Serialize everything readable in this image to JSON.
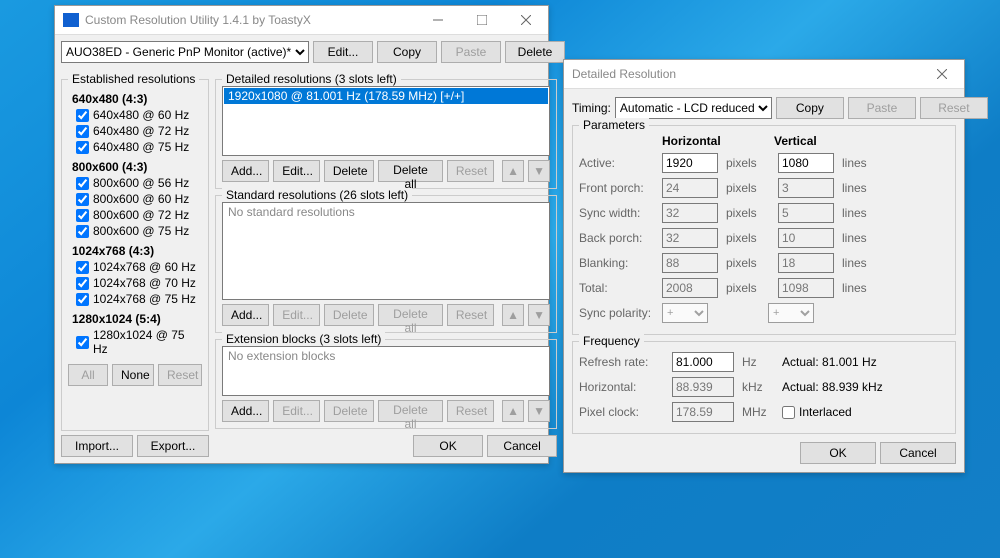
{
  "main": {
    "title": "Custom Resolution Utility 1.4.1 by ToastyX",
    "monitor": "AUO38ED - Generic PnP Monitor (active)*",
    "btn": {
      "edit": "Edit...",
      "copy": "Copy",
      "paste": "Paste",
      "delete": "Delete",
      "add": "Add...",
      "deleteAll": "Delete all",
      "reset": "Reset",
      "all": "All",
      "none": "None",
      "import": "Import...",
      "export": "Export...",
      "ok": "OK",
      "cancel": "Cancel"
    },
    "groups": {
      "established": "Established resolutions",
      "detailed": "Detailed resolutions (3 slots left)",
      "standard": "Standard resolutions (26 slots left)",
      "extension": "Extension blocks (3 slots left)"
    },
    "detailedItem": "1920x1080 @ 81.001 Hz (178.59 MHz) [+/+]",
    "noStandard": "No standard resolutions",
    "noExt": "No extension blocks",
    "res": {
      "g1": "640x480 (4:3)",
      "g1a": "640x480 @ 60 Hz",
      "g1b": "640x480 @ 72 Hz",
      "g1c": "640x480 @ 75 Hz",
      "g2": "800x600 (4:3)",
      "g2a": "800x600 @ 56 Hz",
      "g2b": "800x600 @ 60 Hz",
      "g2c": "800x600 @ 72 Hz",
      "g2d": "800x600 @ 75 Hz",
      "g3": "1024x768 (4:3)",
      "g3a": "1024x768 @ 60 Hz",
      "g3b": "1024x768 @ 70 Hz",
      "g3c": "1024x768 @ 75 Hz",
      "g4": "1280x1024 (5:4)",
      "g4a": "1280x1024 @ 75 Hz"
    }
  },
  "dlg": {
    "title": "Detailed Resolution",
    "timingLabel": "Timing:",
    "timing": "Automatic - LCD reduced",
    "params": "Parameters",
    "hHead": "Horizontal",
    "vHead": "Vertical",
    "rows": {
      "active": {
        "label": "Active:",
        "h": "1920",
        "hu": "pixels",
        "v": "1080",
        "vu": "lines"
      },
      "fp": {
        "label": "Front porch:",
        "h": "24",
        "hu": "pixels",
        "v": "3",
        "vu": "lines"
      },
      "sw": {
        "label": "Sync width:",
        "h": "32",
        "hu": "pixels",
        "v": "5",
        "vu": "lines"
      },
      "bp": {
        "label": "Back porch:",
        "h": "32",
        "hu": "pixels",
        "v": "10",
        "vu": "lines"
      },
      "bl": {
        "label": "Blanking:",
        "h": "88",
        "hu": "pixels",
        "v": "18",
        "vu": "lines"
      },
      "tot": {
        "label": "Total:",
        "h": "2008",
        "hu": "pixels",
        "v": "1098",
        "vu": "lines"
      },
      "sp": {
        "label": "Sync polarity:",
        "hv": "+",
        "vv": "+"
      }
    },
    "freq": {
      "legend": "Frequency",
      "rr": {
        "label": "Refresh rate:",
        "v": "81.000",
        "u": "Hz",
        "actual": "Actual: 81.001 Hz"
      },
      "hz": {
        "label": "Horizontal:",
        "v": "88.939",
        "u": "kHz",
        "actual": "Actual: 88.939 kHz"
      },
      "pc": {
        "label": "Pixel clock:",
        "v": "178.59",
        "u": "MHz"
      },
      "interlaced": "Interlaced"
    },
    "btn": {
      "copy": "Copy",
      "paste": "Paste",
      "reset": "Reset",
      "ok": "OK",
      "cancel": "Cancel"
    }
  }
}
